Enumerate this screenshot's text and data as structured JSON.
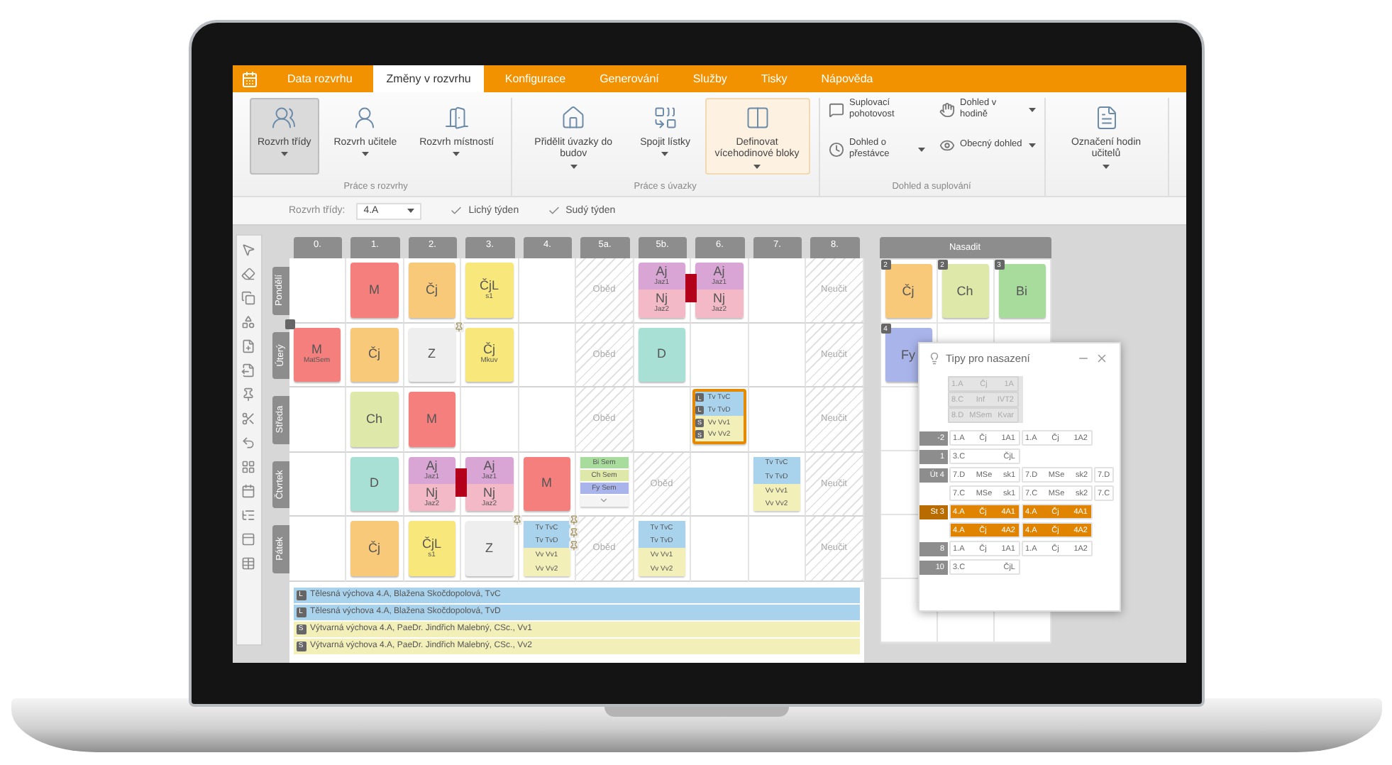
{
  "menu": {
    "tabs": [
      {
        "label": "Data rozvrhu",
        "selected": false
      },
      {
        "label": "Změny v rozvrhu",
        "selected": true
      },
      {
        "label": "Konfigurace",
        "selected": false
      },
      {
        "label": "Generování",
        "selected": false
      },
      {
        "label": "Služby",
        "selected": false
      },
      {
        "label": "Tisky",
        "selected": false
      },
      {
        "label": "Nápověda",
        "selected": false
      }
    ]
  },
  "ribbon": {
    "groups": [
      {
        "title": "Práce s rozvrhy",
        "buttons": [
          {
            "label": "Rozvrh třídy",
            "kind": "large",
            "selected": true,
            "highlighted": false,
            "dropdown": true
          },
          {
            "label": "Rozvrh učitele",
            "kind": "large",
            "selected": false,
            "highlighted": false,
            "dropdown": true
          },
          {
            "label": "Rozvrh místností",
            "kind": "large",
            "selected": false,
            "highlighted": false,
            "dropdown": true
          }
        ]
      },
      {
        "title": "Práce s úvazky",
        "buttons": [
          {
            "label": "Přidělit úvazky do budov",
            "kind": "large",
            "selected": false,
            "highlighted": false,
            "dropdown": true
          },
          {
            "label": "Spojit lístky",
            "kind": "large",
            "selected": false,
            "highlighted": false,
            "dropdown": true
          },
          {
            "label": "Definovat vícehodinové bloky",
            "kind": "large",
            "selected": false,
            "highlighted": true,
            "dropdown": true
          }
        ]
      },
      {
        "title": "Dohled a suplování",
        "buttons": [
          {
            "label": "Suplovací pohotovost",
            "kind": "small",
            "dropdown": false
          },
          {
            "label": "Dohled o přestávce",
            "kind": "small",
            "dropdown": true
          },
          {
            "label": "Dohled v hodině",
            "kind": "small",
            "dropdown": true
          },
          {
            "label": "Obecný dohled",
            "kind": "small",
            "dropdown": true
          }
        ]
      },
      {
        "buttons": [
          {
            "label": "Označení hodin učitelů",
            "kind": "large",
            "selected": false,
            "highlighted": false,
            "dropdown": true
          }
        ]
      }
    ]
  },
  "toolbar": {
    "class_label": "Rozvrh třídy:",
    "class_value": "4.A",
    "checks": [
      {
        "label": "Lichý týden",
        "checked": true
      },
      {
        "label": "Sudý týden",
        "checked": true
      }
    ]
  },
  "timetable": {
    "periods": [
      "0.",
      "1.",
      "2.",
      "3.",
      "4.",
      "5a.",
      "5b.",
      "6.",
      "7.",
      "8."
    ],
    "rows": [
      {
        "day": "Pondělí",
        "cells": [
          {
            "kind": "empty"
          },
          {
            "kind": "lesson",
            "subject": "M",
            "color": "#f47f7c",
            "pinned": false,
            "marker": false
          },
          {
            "kind": "lesson",
            "subject": "Čj",
            "color": "#f9c97a",
            "pinned": false,
            "marker": false
          },
          {
            "kind": "lesson",
            "subject": "ČjL",
            "sub": "s1",
            "color": "#f8e77a",
            "pinned": false,
            "marker": false
          },
          {
            "kind": "empty"
          },
          {
            "kind": "blocked",
            "text": "Oběd"
          },
          {
            "kind": "split",
            "linked": true,
            "parts": [
              {
                "subject": "Aj",
                "sub": "Jaz1",
                "color": "#d8a5d4"
              },
              {
                "subject": "Nj",
                "sub": "Jaz2",
                "color": "#f3b9c6"
              }
            ]
          },
          {
            "kind": "split",
            "linked": false,
            "parts": [
              {
                "subject": "Aj",
                "sub": "Jaz1",
                "color": "#d8a5d4"
              },
              {
                "subject": "Nj",
                "sub": "Jaz2",
                "color": "#f3b9c6"
              }
            ]
          },
          {
            "kind": "empty"
          },
          {
            "kind": "blocked",
            "text": "Neučit"
          }
        ]
      },
      {
        "day": "Úterý",
        "cells": [
          {
            "kind": "lesson",
            "subject": "M",
            "sub": "MatSem",
            "color": "#f47f7c",
            "pinned": false,
            "marker": true
          },
          {
            "kind": "lesson",
            "subject": "Čj",
            "color": "#f9c97a",
            "pinned": false,
            "marker": false
          },
          {
            "kind": "lesson",
            "subject": "Z",
            "color": "#eeeeee",
            "pinned": true,
            "marker": false
          },
          {
            "kind": "lesson",
            "subject": "Čj",
            "sub": "Mkuv",
            "color": "#f8e77a",
            "pinned": false,
            "marker": false
          },
          {
            "kind": "empty"
          },
          {
            "kind": "blocked",
            "text": "Oběd"
          },
          {
            "kind": "lesson",
            "subject": "D",
            "color": "#a8e0d5",
            "pinned": false,
            "marker": false
          },
          {
            "kind": "empty"
          },
          {
            "kind": "empty"
          },
          {
            "kind": "blocked",
            "text": "Neučit"
          }
        ]
      },
      {
        "day": "Středa",
        "cells": [
          {
            "kind": "empty"
          },
          {
            "kind": "lesson",
            "subject": "Ch",
            "color": "#dde8a9",
            "pinned": false,
            "marker": false
          },
          {
            "kind": "lesson",
            "subject": "M",
            "color": "#f47f7c",
            "pinned": false,
            "marker": false
          },
          {
            "kind": "empty"
          },
          {
            "kind": "empty"
          },
          {
            "kind": "blocked",
            "text": "Oběd"
          },
          {
            "kind": "empty"
          },
          {
            "kind": "group",
            "selected": true,
            "pinned": false,
            "parts": [
              {
                "label": "Tv TvC",
                "badge": "L",
                "color": "#a9d3ec"
              },
              {
                "label": "Tv TvD",
                "badge": "L",
                "color": "#a9d3ec"
              },
              {
                "label": "Vv Vv1",
                "badge": "S",
                "color": "#f2efb9"
              },
              {
                "label": "Vv Vv2",
                "badge": "S",
                "color": "#f2efb9"
              }
            ]
          },
          {
            "kind": "empty"
          },
          {
            "kind": "blocked",
            "text": "Neučit"
          }
        ]
      },
      {
        "day": "Čtvrtek",
        "cells": [
          {
            "kind": "empty"
          },
          {
            "kind": "lesson",
            "subject": "D",
            "color": "#a8e0d5",
            "pinned": false,
            "marker": false
          },
          {
            "kind": "split",
            "linked": true,
            "parts": [
              {
                "subject": "Aj",
                "sub": "Jaz1",
                "color": "#d8a5d4"
              },
              {
                "subject": "Nj",
                "sub": "Jaz2",
                "color": "#f3b9c6"
              }
            ]
          },
          {
            "kind": "split",
            "linked": false,
            "parts": [
              {
                "subject": "Aj",
                "sub": "Jaz1",
                "color": "#d8a5d4"
              },
              {
                "subject": "Nj",
                "sub": "Jaz2",
                "color": "#f3b9c6"
              }
            ]
          },
          {
            "kind": "lesson",
            "subject": "M",
            "color": "#f47f7c",
            "pinned": false,
            "marker": false
          },
          {
            "kind": "options",
            "parts": [
              {
                "label": "Bi Sem",
                "color": "#a8dc9d"
              },
              {
                "label": "Ch Sem",
                "color": "#dde8a9"
              },
              {
                "label": "Fy Sem",
                "color": "#a9b4ea"
              }
            ]
          },
          {
            "kind": "blocked",
            "text": "Oběd"
          },
          {
            "kind": "empty"
          },
          {
            "kind": "group",
            "selected": false,
            "pinned": false,
            "parts": [
              {
                "label": "Tv TvC",
                "color": "#a9d3ec"
              },
              {
                "label": "Tv TvD",
                "color": "#a9d3ec"
              },
              {
                "label": "Vv Vv1",
                "color": "#f2efb9"
              },
              {
                "label": "Vv Vv2",
                "color": "#f2efb9"
              }
            ]
          },
          {
            "kind": "blocked",
            "text": "Neučit"
          }
        ]
      },
      {
        "day": "Pátek",
        "cells": [
          {
            "kind": "empty"
          },
          {
            "kind": "lesson",
            "subject": "Čj",
            "color": "#f9c97a",
            "pinned": false,
            "marker": false
          },
          {
            "kind": "lesson",
            "subject": "ČjL",
            "sub": "s1",
            "color": "#f8e77a",
            "pinned": false,
            "marker": false
          },
          {
            "kind": "lesson",
            "subject": "Z",
            "color": "#eeeeee",
            "pinned": true,
            "marker": false
          },
          {
            "kind": "group",
            "selected": false,
            "pinned": true,
            "parts": [
              {
                "label": "Tv TvC",
                "color": "#a9d3ec"
              },
              {
                "label": "Tv TvD",
                "color": "#a9d3ec"
              },
              {
                "label": "Vv Vv1",
                "color": "#f2efb9"
              },
              {
                "label": "Vv Vv2",
                "color": "#f2efb9"
              }
            ]
          },
          {
            "kind": "blocked",
            "text": "Oběd"
          },
          {
            "kind": "group",
            "selected": false,
            "pinned": false,
            "parts": [
              {
                "label": "Tv TvC",
                "color": "#a9d3ec"
              },
              {
                "label": "Tv TvD",
                "color": "#a9d3ec"
              },
              {
                "label": "Vv Vv1",
                "color": "#f2efb9"
              },
              {
                "label": "Vv Vv2",
                "color": "#f2efb9"
              }
            ]
          },
          {
            "kind": "empty"
          },
          {
            "kind": "empty"
          },
          {
            "kind": "blocked",
            "text": "Neučit"
          }
        ]
      }
    ],
    "legend": [
      {
        "badge": "L",
        "text": "Tělesná výchova 4.A, Blažena Skočdopolová, TvC",
        "color": "#a9d3ec"
      },
      {
        "badge": "L",
        "text": "Tělesná výchova 4.A, Blažena Skočdopolová, TvD",
        "color": "#a9d3ec"
      },
      {
        "badge": "S",
        "text": "Výtvarná výchova 4.A, PaeDr. Jindřich Malebný, CSc., Vv1",
        "color": "#f2efb9"
      },
      {
        "badge": "S",
        "text": "Výtvarná výchova 4.A, PaeDr. Jindřich Malebný, CSc., Vv2",
        "color": "#f2efb9"
      }
    ]
  },
  "deploy": {
    "title": "Nasadit",
    "cards": [
      {
        "subject": "Čj",
        "count": "2",
        "color": "#f9c97a"
      },
      {
        "subject": "Ch",
        "count": "2",
        "color": "#dde8a9"
      },
      {
        "subject": "Bi",
        "count": "3",
        "color": "#a8dc9d"
      },
      {
        "subject": "Fy",
        "count": "4",
        "color": "#a9b4ea"
      }
    ]
  },
  "tips": {
    "title": "Tipy pro nasazení",
    "suggested": [
      [
        "1.A",
        "Čj",
        "1A"
      ],
      [
        "8.C",
        "Inf",
        "IVT2"
      ],
      [
        "8.D",
        "MSem",
        "Kvar"
      ]
    ],
    "rows": [
      {
        "label": "-2",
        "selected": false,
        "items": [
          [
            "1.A",
            "Čj",
            "1A1"
          ],
          [
            "1.A",
            "Čj",
            "1A2"
          ]
        ]
      },
      {
        "label": "1",
        "selected": false,
        "items": [
          [
            "3.C",
            "ČjL"
          ]
        ]
      },
      {
        "label": "Út 4",
        "selected": false,
        "items": [
          [
            "7.D",
            "MSe",
            "sk1"
          ],
          [
            "7.D",
            "MSe",
            "sk2"
          ],
          [
            "7.D"
          ]
        ]
      },
      {
        "selected": false,
        "items": [
          [
            "7.C",
            "MSe",
            "sk1"
          ],
          [
            "7.C",
            "MSe",
            "sk2"
          ],
          [
            "7.C"
          ]
        ]
      },
      {
        "label": "St 3",
        "selected": true,
        "items": [
          [
            "4.A",
            "Čj",
            "4A1"
          ],
          [
            "4.A",
            "Čj",
            "4A1"
          ]
        ]
      },
      {
        "selected": true,
        "items": [
          [
            "4.A",
            "Čj",
            "4A2"
          ],
          [
            "4.A",
            "Čj",
            "4A2"
          ]
        ]
      },
      {
        "label": "8",
        "selected": false,
        "items": [
          [
            "1.A",
            "Čj",
            "1A1"
          ],
          [
            "1.A",
            "Čj",
            "1A2"
          ]
        ]
      },
      {
        "label": "10",
        "selected": false,
        "items": [
          [
            "3.C",
            "ČjL"
          ]
        ]
      }
    ]
  }
}
